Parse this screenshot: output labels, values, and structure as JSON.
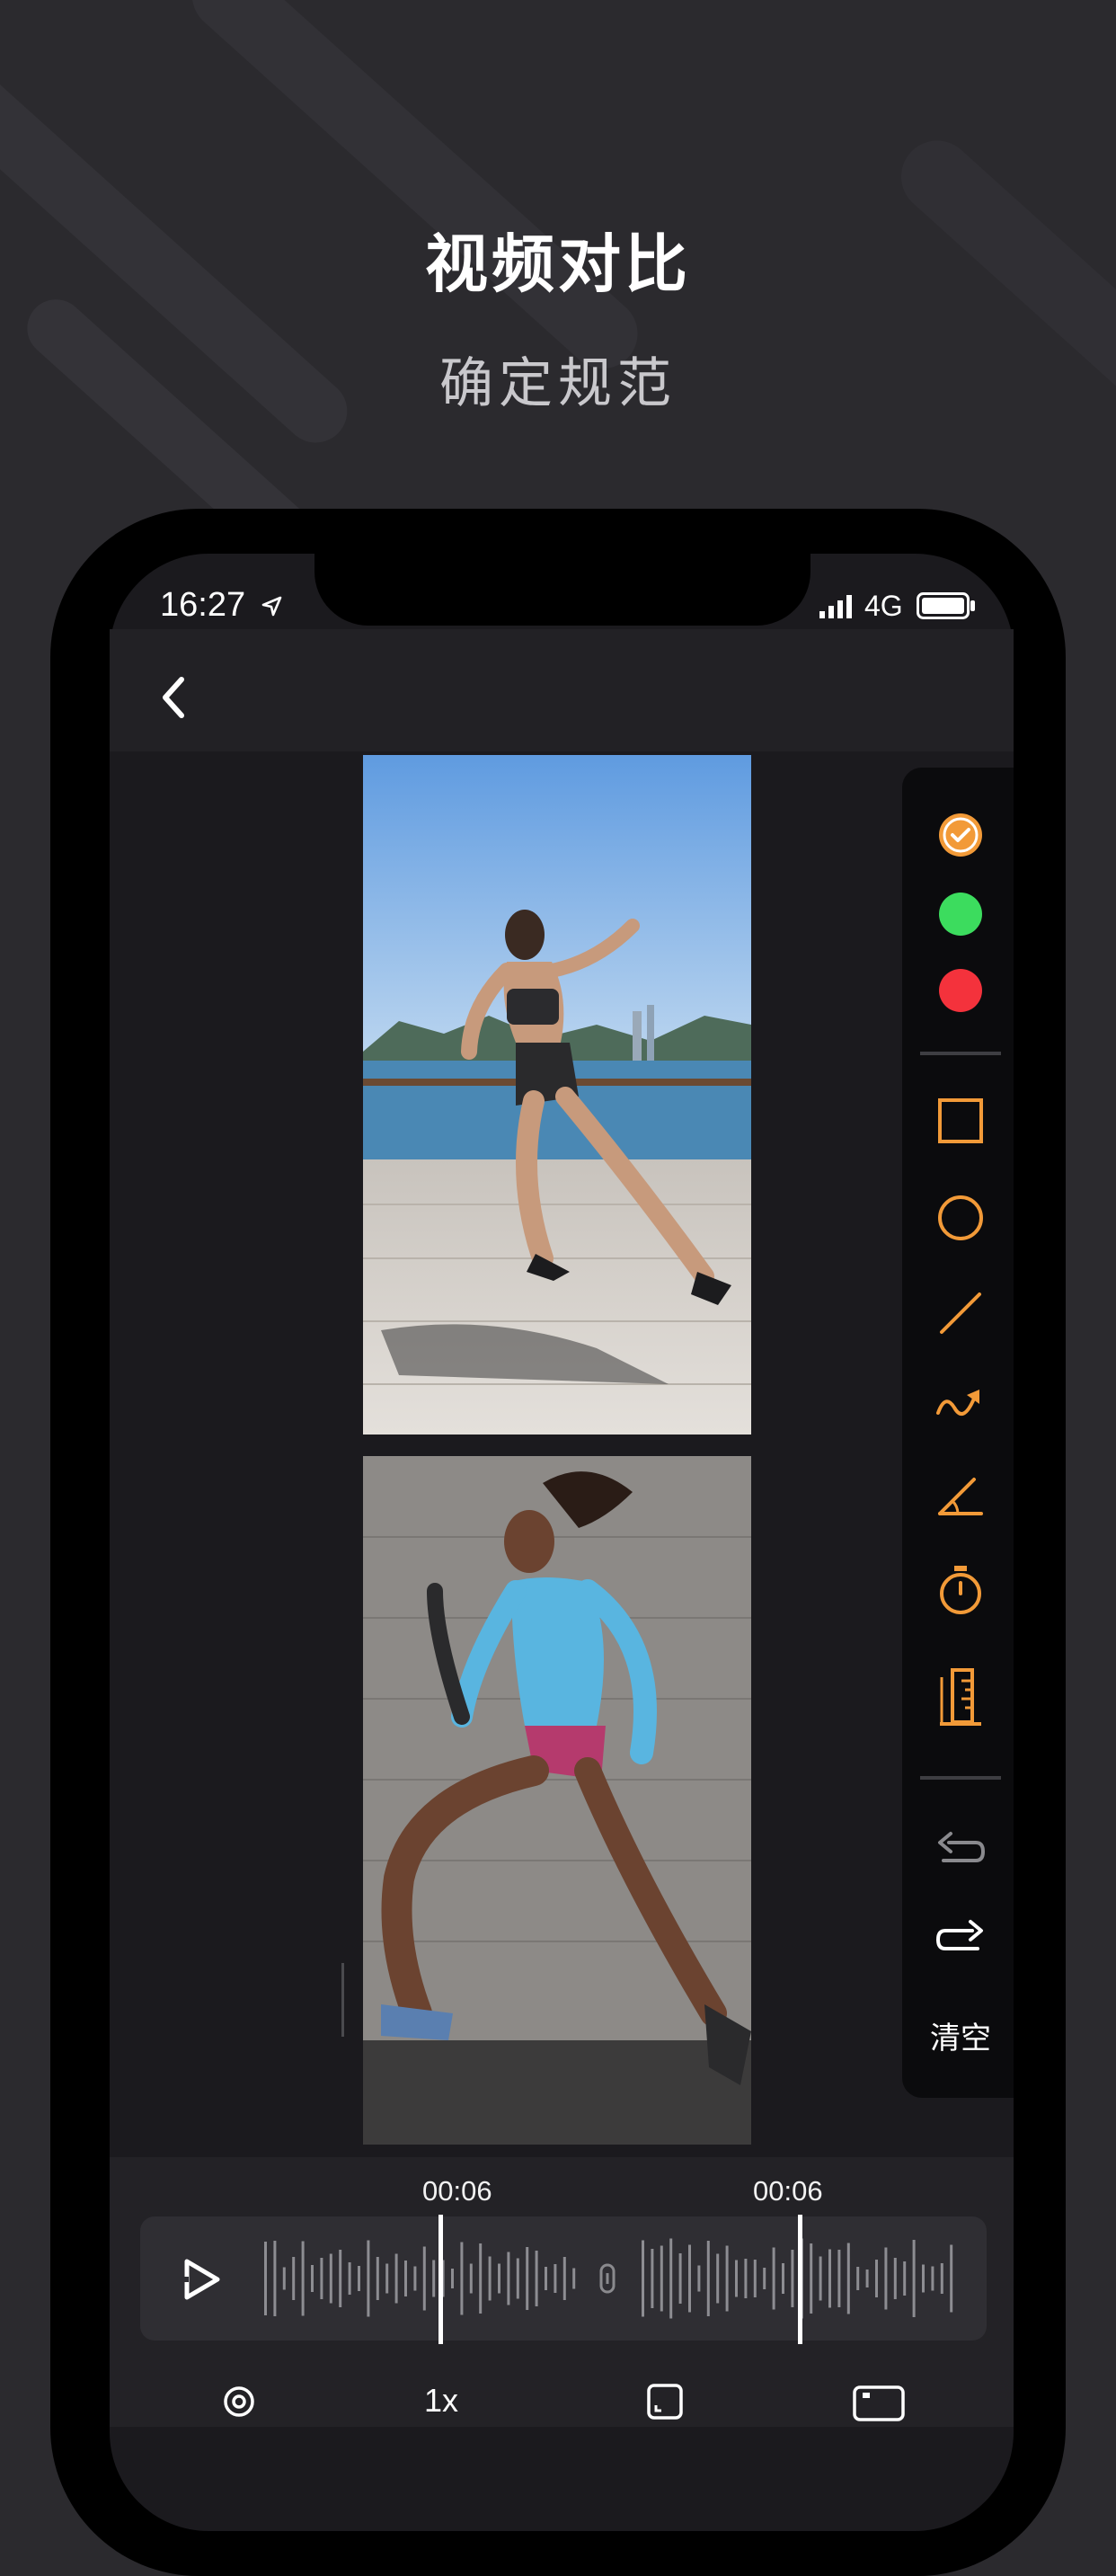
{
  "hero": {
    "title": "视频对比",
    "subtitle": "确定规范"
  },
  "status_bar": {
    "time": "16:27",
    "network": "4G"
  },
  "toolbar": {
    "colors": [
      {
        "name": "orange",
        "hex": "#f29a38",
        "selected": true
      },
      {
        "name": "green",
        "hex": "#3cdc5e",
        "selected": false
      },
      {
        "name": "red",
        "hex": "#f4323c",
        "selected": false
      }
    ],
    "accent": "#f29a38",
    "tools": [
      "rectangle-icon",
      "circle-icon",
      "line-icon",
      "curve-arrow-icon",
      "angle-icon",
      "stopwatch-icon",
      "ruler-icon"
    ],
    "history": [
      "undo-icon",
      "redo-icon"
    ],
    "clear_label": "清空"
  },
  "timeline": {
    "left_time": "00:06",
    "right_time": "00:06"
  },
  "bottom_bar": {
    "speed_label": "1x",
    "icons": [
      "settings-icon",
      "speed-label",
      "fullscreen-icon",
      "camera-icon"
    ]
  }
}
